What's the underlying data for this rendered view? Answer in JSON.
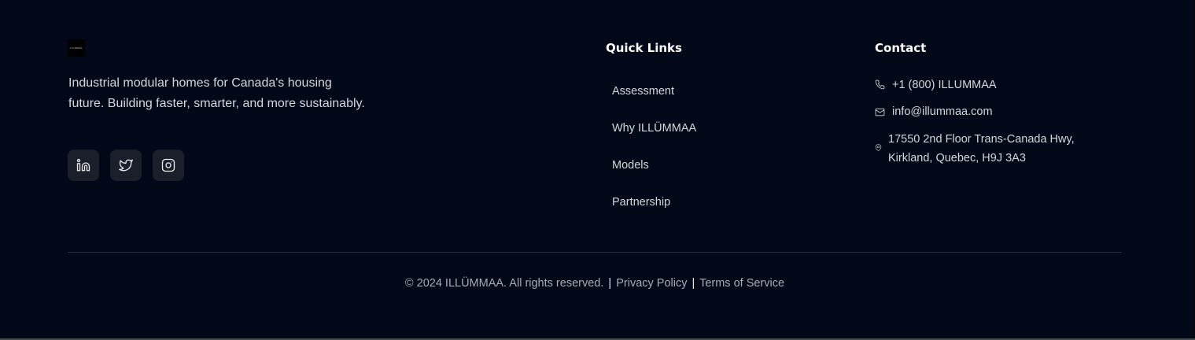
{
  "brand": {
    "logo_text": "ILLÜMMAA",
    "tagline": "Industrial modular homes for Canada's housing future. Building faster, smarter, and more sustainably."
  },
  "socials": [
    {
      "icon": "linkedin-icon"
    },
    {
      "icon": "twitter-icon"
    },
    {
      "icon": "instagram-icon"
    }
  ],
  "quick_links": {
    "title": "Quick Links",
    "items": [
      {
        "label": "Assessment"
      },
      {
        "label": "Why ILLÜMMAA"
      },
      {
        "label": "Models"
      },
      {
        "label": "Partnership"
      }
    ]
  },
  "contact": {
    "title": "Contact",
    "phone": "+1 (800) ILLUMMAA",
    "email": "info@illummaa.com",
    "address": "17550 2nd Floor Trans-Canada Hwy, Kirkland, Quebec, H9J 3A3"
  },
  "legal": {
    "copyright": "© 2024 ILLÜMMAA. All rights reserved.",
    "separator": "|",
    "privacy": "Privacy Policy",
    "terms": "Terms of Service"
  },
  "colors": {
    "background": "#020817",
    "social_button_bg": "#1b1f2b",
    "heading": "#ffffff",
    "text": "#d4d7de",
    "muted": "#a7acb6"
  }
}
